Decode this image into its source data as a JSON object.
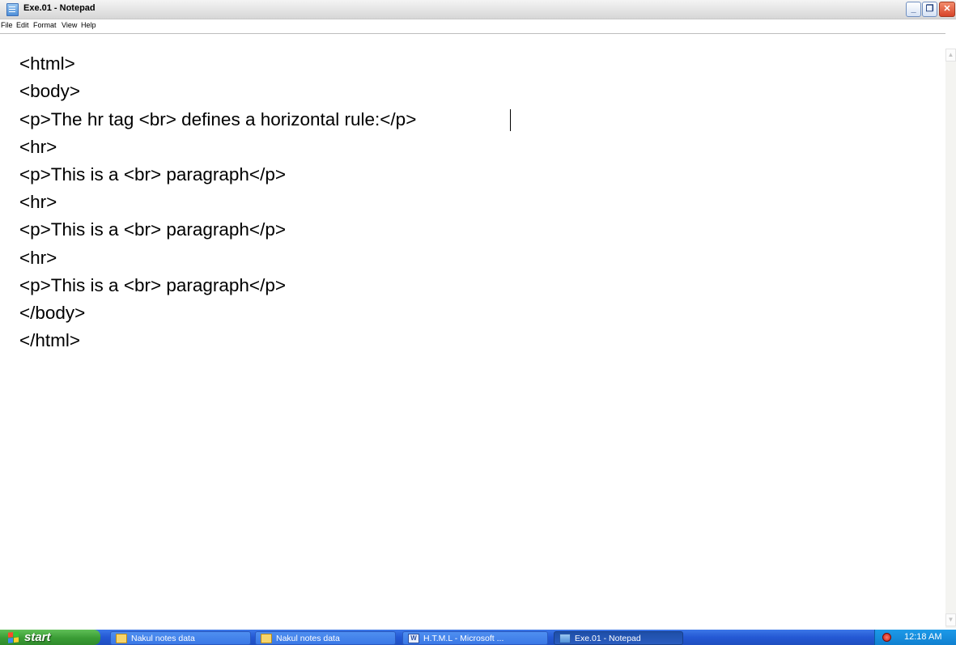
{
  "window": {
    "title": "Exe.01 - Notepad",
    "controls": {
      "minimize": "_",
      "maximize": "❐",
      "close": "✕"
    }
  },
  "menu": {
    "items": [
      {
        "label": "File"
      },
      {
        "label": "Edit"
      },
      {
        "label": "Format"
      },
      {
        "label": "View"
      },
      {
        "label": "Help"
      }
    ]
  },
  "editor": {
    "lines": [
      "<html>",
      "<body>",
      "<p>The hr tag <br> defines a horizontal rule:</p>",
      "<hr>",
      "<p>This is a <br> paragraph</p>",
      "<hr>",
      "<p>This is a <br> paragraph</p>",
      "<hr>",
      "<p>This is a <br> paragraph</p>",
      "</body>",
      "</html>"
    ]
  },
  "scrollbar": {
    "up_arrow": "▲",
    "down_arrow": "▼"
  },
  "taskbar": {
    "start_label": "start",
    "buttons": [
      {
        "label": "Nakul notes data",
        "icon": "folder-icon"
      },
      {
        "label": "Nakul notes data",
        "icon": "folder-icon"
      },
      {
        "label": "H.T.M.L - Microsoft ...",
        "icon": "word-icon"
      },
      {
        "label": "Exe.01 - Notepad",
        "icon": "notepad-icon",
        "active": true
      }
    ],
    "clock": "12:18 AM"
  }
}
